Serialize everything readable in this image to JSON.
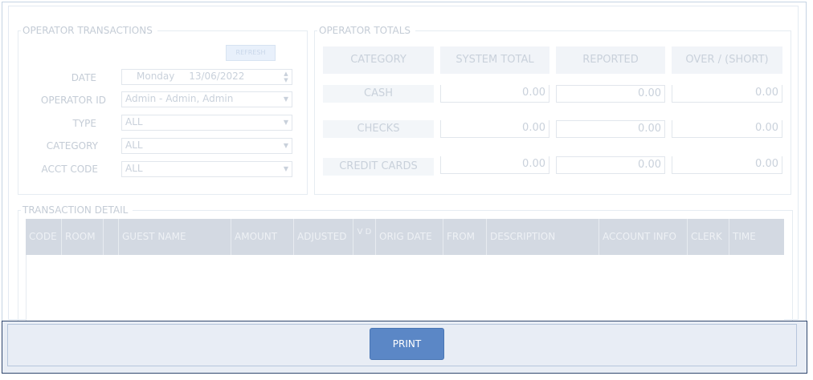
{
  "operator_transactions": {
    "legend": "OPERATOR TRANSACTIONS",
    "refresh_label": "REFRESH",
    "date_label": "DATE",
    "date_day": "Monday",
    "date_value": "13/06/2022",
    "operator_id_label": "OPERATOR ID",
    "operator_id_value": "Admin - Admin, Admin",
    "type_label": "TYPE",
    "type_value": "ALL",
    "category_label": "CATEGORY",
    "category_value": "ALL",
    "acct_code_label": "ACCT CODE",
    "acct_code_value": "ALL"
  },
  "operator_totals": {
    "legend": "OPERATOR TOTALS",
    "headers": [
      "CATEGORY",
      "SYSTEM TOTAL",
      "REPORTED",
      "OVER / (SHORT)"
    ],
    "rows": [
      {
        "category": "CASH",
        "system_total": "0.00",
        "reported": "0.00",
        "over_short": "0.00"
      },
      {
        "category": "CHECKS",
        "system_total": "0.00",
        "reported": "0.00",
        "over_short": "0.00"
      },
      {
        "category": "CREDIT CARDS",
        "system_total": "0.00",
        "reported": "0.00",
        "over_short": "0.00"
      }
    ]
  },
  "transaction_detail": {
    "legend": "TRANSACTION DETAIL",
    "columns": [
      "CODE",
      "ROOM",
      "",
      "GUEST NAME",
      "AMOUNT",
      "ADJUSTED",
      "V D",
      "ORIG DATE",
      "FROM",
      "DESCRIPTION",
      "ACCOUNT INFO",
      "CLERK",
      "TIME"
    ]
  },
  "footer": {
    "print_label": "PRINT"
  },
  "icons": {
    "dropdown": "chevron-down-icon",
    "spinner": "spinner-arrows-icon"
  },
  "colors": {
    "print_button": "#5b87c6",
    "grid_header": "#d3d9e2",
    "footer_bg": "#e8edf5"
  }
}
